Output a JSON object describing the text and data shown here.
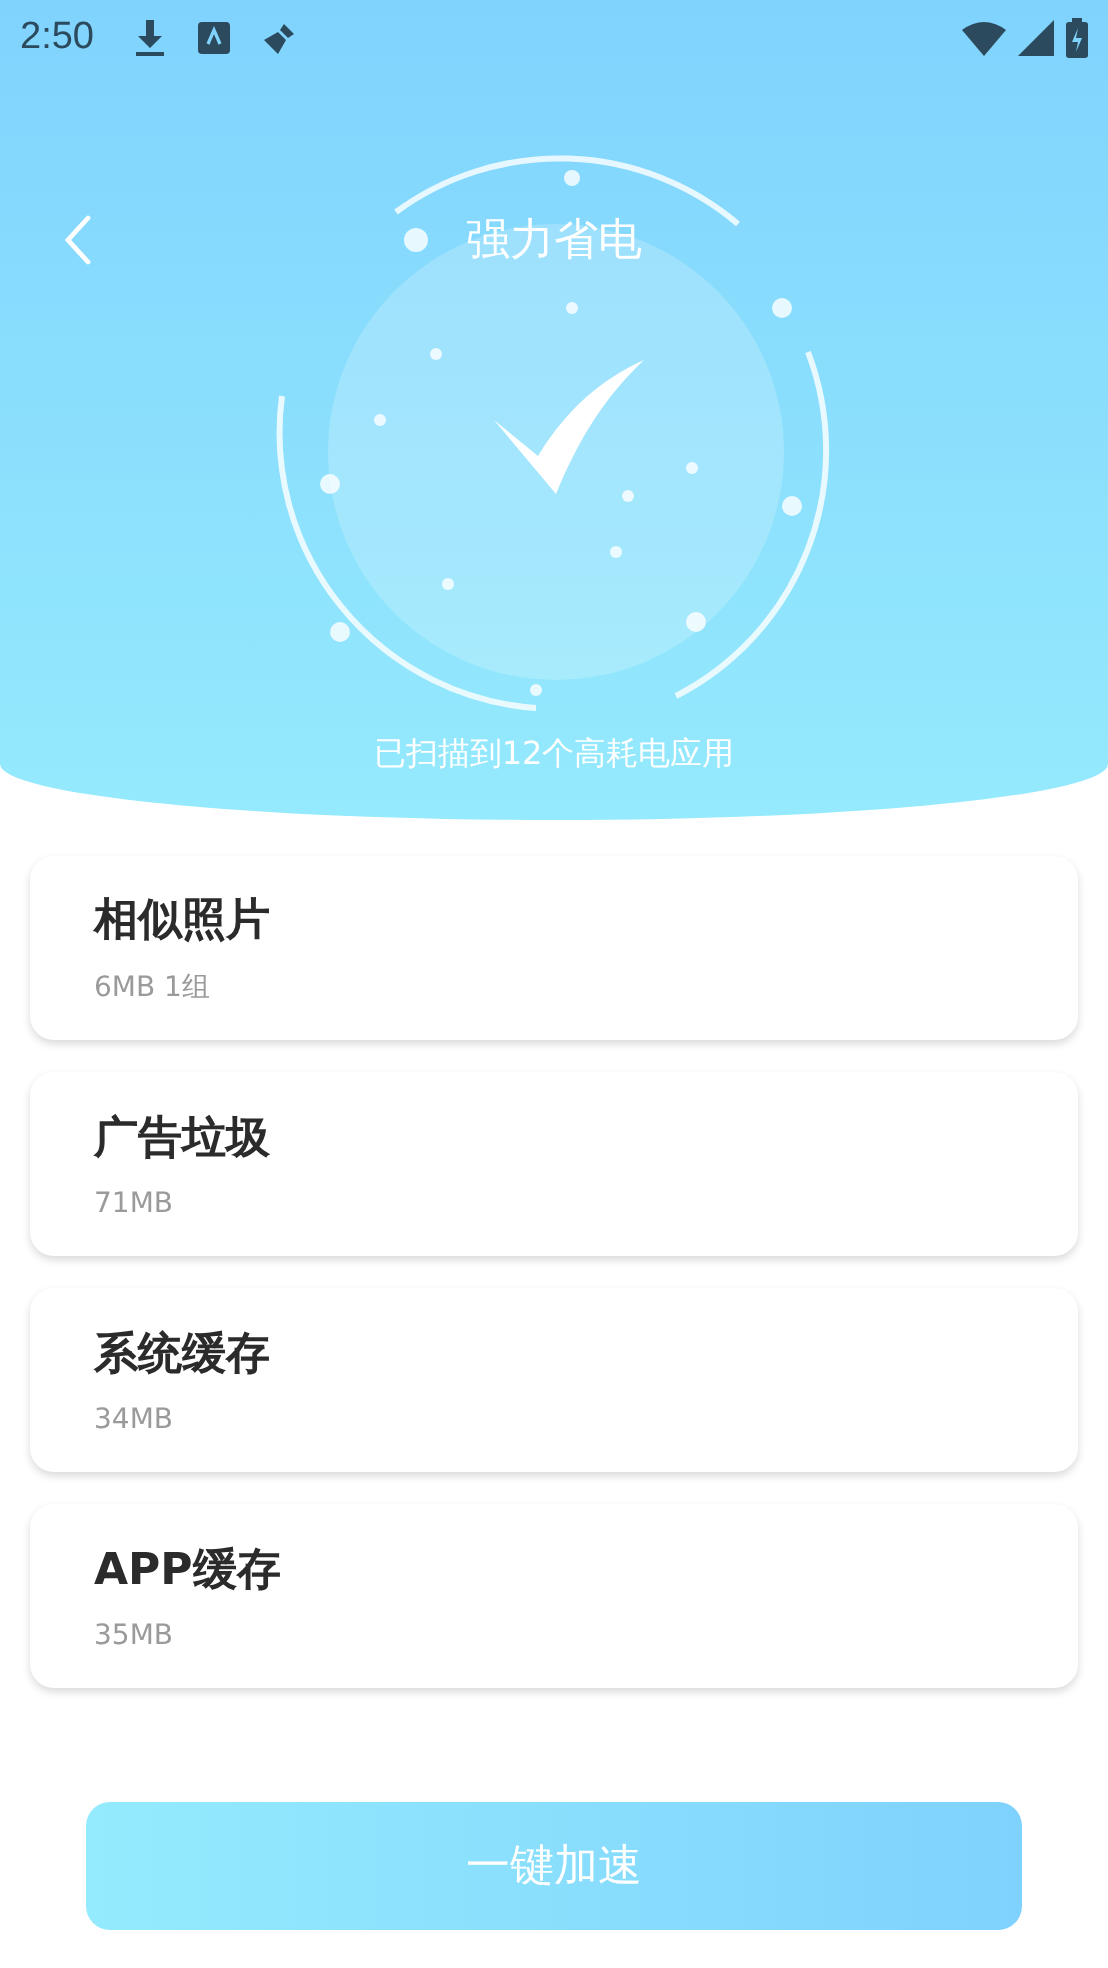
{
  "status_bar": {
    "time": "2:50"
  },
  "header": {
    "title": "强力省电",
    "subtitle": "已扫描到12个高耗电应用"
  },
  "items": [
    {
      "title": "相似照片",
      "size": "6MB 1组"
    },
    {
      "title": "广告垃圾",
      "size": "71MB"
    },
    {
      "title": "系统缓存",
      "size": "34MB"
    },
    {
      "title": "APP缓存",
      "size": "35MB"
    }
  ],
  "button": {
    "label": "一键加速"
  }
}
